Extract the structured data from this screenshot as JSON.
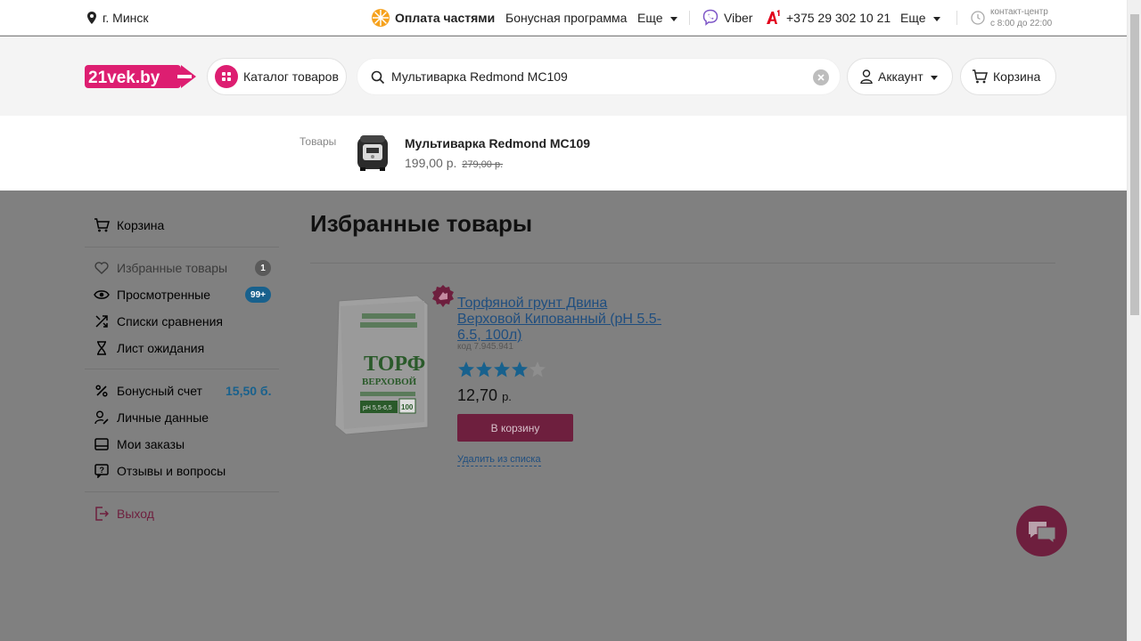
{
  "topbar": {
    "city": "г. Минск",
    "installments": "Оплата частями",
    "bonus_program": "Бонусная программа",
    "more1": "Еще",
    "viber": "Viber",
    "phone": "+375 29 302 10 21",
    "more2": "Еще",
    "contact_center": "контакт-центр",
    "hours": "с 8:00 до 22:00"
  },
  "header": {
    "logo_text": "21vek.by",
    "catalog_label": "Каталог товаров",
    "search_value": "Мультиварка Redmond MC109",
    "account_label": "Аккаунт",
    "cart_label": "Корзина"
  },
  "suggestions": {
    "section_label": "Товары",
    "items": [
      {
        "name": "Мультиварка Redmond MC109",
        "price": "199,00 р.",
        "old_price": "279,00 р."
      }
    ]
  },
  "sidebar": {
    "cart": "Корзина",
    "favorites": "Избранные товары",
    "favorites_count": "1",
    "viewed": "Просмотренные",
    "viewed_count": "99+",
    "compare": "Списки сравнения",
    "waitlist": "Лист ожидания",
    "bonus": "Бонусный счет",
    "bonus_value": "15,50 б.",
    "personal": "Личные данные",
    "orders": "Мои заказы",
    "reviews": "Отзывы и вопросы",
    "logout": "Выход"
  },
  "main": {
    "title": "Избранные товары",
    "product": {
      "name": "Торфяной грунт Двина Верховой Кипованный (pH 5.5-6.5, 100л)",
      "code": "код 7.945.941",
      "rating": 4,
      "rating_max": 5,
      "price": "12,70",
      "currency": "р.",
      "add_to_cart": "В корзину",
      "remove": "Удалить из списка",
      "bag_text1": "ТОРФ",
      "bag_text2": "ВЕРХОВОЙ",
      "bag_text3": "pH 5,5-6,5",
      "bag_text4": "100"
    }
  },
  "colors": {
    "brand": "#dd1e71",
    "overlay": "#808080",
    "link": "#1f4e7f",
    "badge_blue": "#18618d"
  }
}
